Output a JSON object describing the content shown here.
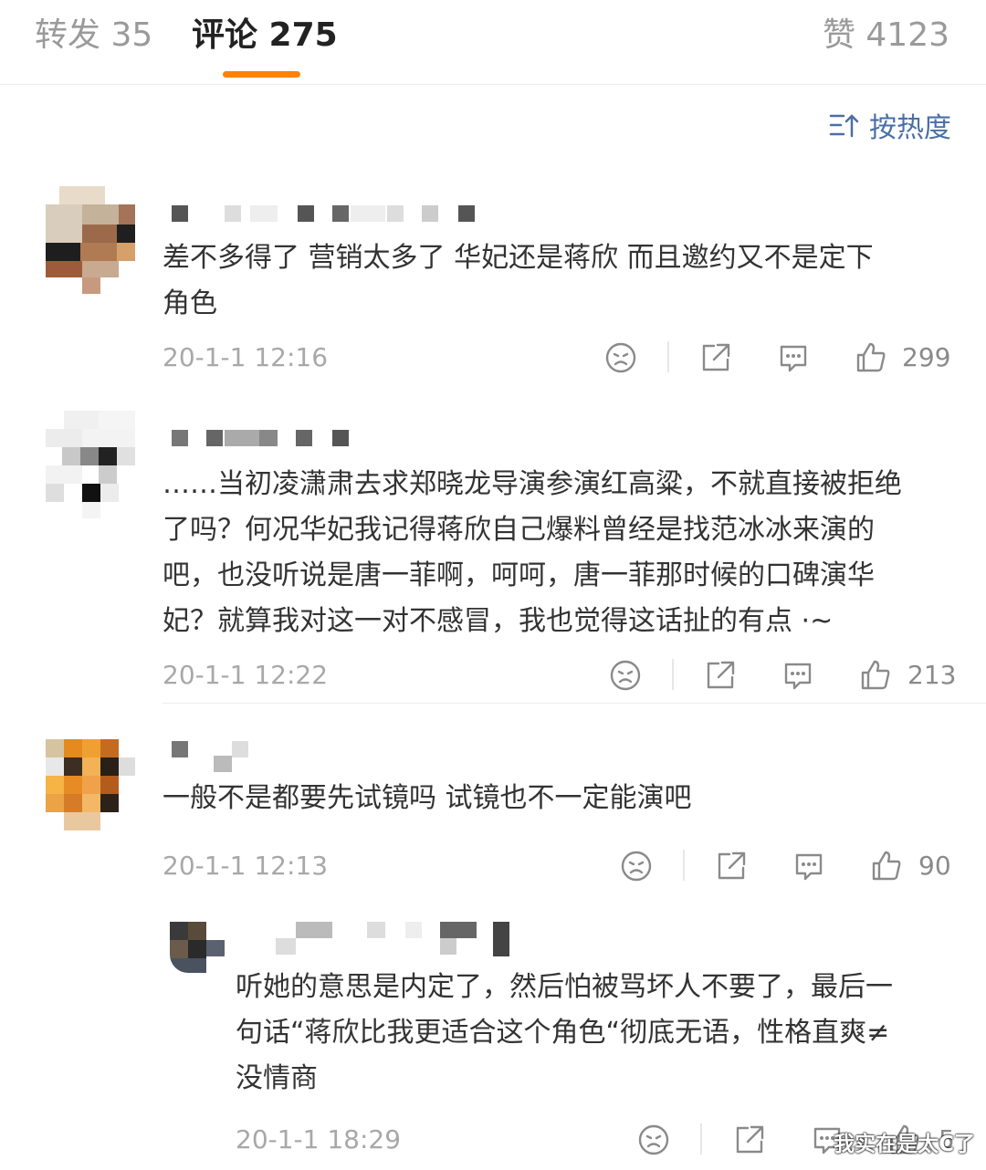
{
  "tabs": [
    {
      "label": "转发 35"
    },
    {
      "label": "评论 275"
    },
    {
      "label": "赞 4123"
    }
  ],
  "accent_color": "#ff8200",
  "sort": {
    "label": "按热度",
    "icon": "sort-icon"
  },
  "comments": [
    {
      "lines": [
        "差不多得了 营销太多了 华妃还是蒋欣 而且邀约又不是定下",
        "角色"
      ],
      "time": "20-1-1 12:16",
      "likes": "299"
    },
    {
      "lines": [
        "……当初凌潇肃去求郑晓龙导演参演红高粱，不就直接被拒绝",
        "了吗？何况华妃我记得蒋欣自己爆料曾经是找范冰冰来演的",
        "吧，也没听说是唐一菲啊，呵呵，唐一菲那时候的口碑演华",
        "妃？就算我对这一对不感冒，我也觉得这话扯的有点 ·~"
      ],
      "time": "20-1-1 12:22",
      "likes": "213"
    },
    {
      "lines": [
        "一般不是都要先试镜吗 试镜也不一定能演吧"
      ],
      "time": "20-1-1 12:13",
      "likes": "90"
    }
  ],
  "reply": {
    "lines": [
      "听她的意思是内定了，然后怕被骂坏人不要了，最后一",
      "句话“蒋欣比我更适合这个角色“彻底无语，性格直爽≠",
      "没情商"
    ],
    "time": "20-1-1 18:29",
    "likes": "5"
  },
  "action_icons": [
    "dislike-icon",
    "share-icon",
    "comment-icon",
    "like-icon"
  ],
  "watermark": "我实在是太C了"
}
